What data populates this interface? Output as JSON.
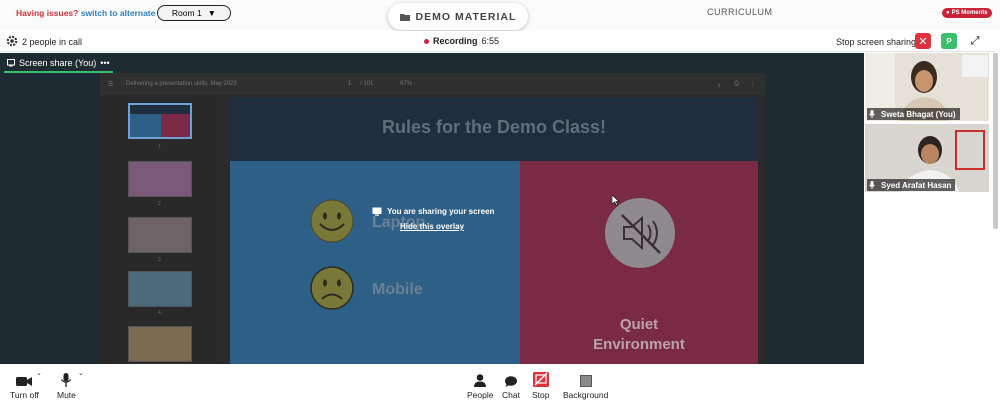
{
  "topbar": {
    "issues_text": "Having issues?",
    "alternate_link": "switch to alternate room",
    "room_label": "Room 1",
    "room_caret": "▼",
    "demo_tab_label": "DEMO MATERIAL",
    "curriculum_label": "CURRICULUM",
    "moments_badge": "PS Moments"
  },
  "callbar": {
    "people_in_call": "2 people in call",
    "recording_label": "Recording",
    "recording_time": "6:55",
    "stop_share_label": "Stop screen sharing",
    "close_glyph": "✕",
    "participant_initial": "P",
    "expand_glyph": "⤢"
  },
  "stage": {
    "share_tab_label": "Screen share (You)",
    "share_tab_menu": "•••",
    "pdf": {
      "title": "Delivering a presentation skills: May 2023",
      "page": "1",
      "page_total": "/ 101",
      "zoom": "67%",
      "thumb_numbers": [
        "1",
        "2",
        "3",
        "4"
      ]
    },
    "slide": {
      "title": "Rules for the Demo Class!",
      "laptop": "Laptop",
      "mobile": "Mobile",
      "quiet_line1": "Quiet",
      "quiet_line2": "Environment"
    },
    "overlay": {
      "sharing_text": "You are sharing your screen",
      "hide_link": "Hide this overlay"
    }
  },
  "participants": [
    {
      "name": "Sweta Bhagat (You)",
      "icon": "mic-icon"
    },
    {
      "name": "Syed Arafat Hasan",
      "icon": "mic-icon"
    }
  ],
  "bottombar": {
    "turn_off": "Turn off",
    "mute": "Mute",
    "people": "People",
    "chat": "Chat",
    "stop": "Stop",
    "background": "Background"
  },
  "colors": {
    "accent_red": "#d6203a",
    "accent_green": "#39c06b",
    "link_blue": "#2d7fc2"
  }
}
